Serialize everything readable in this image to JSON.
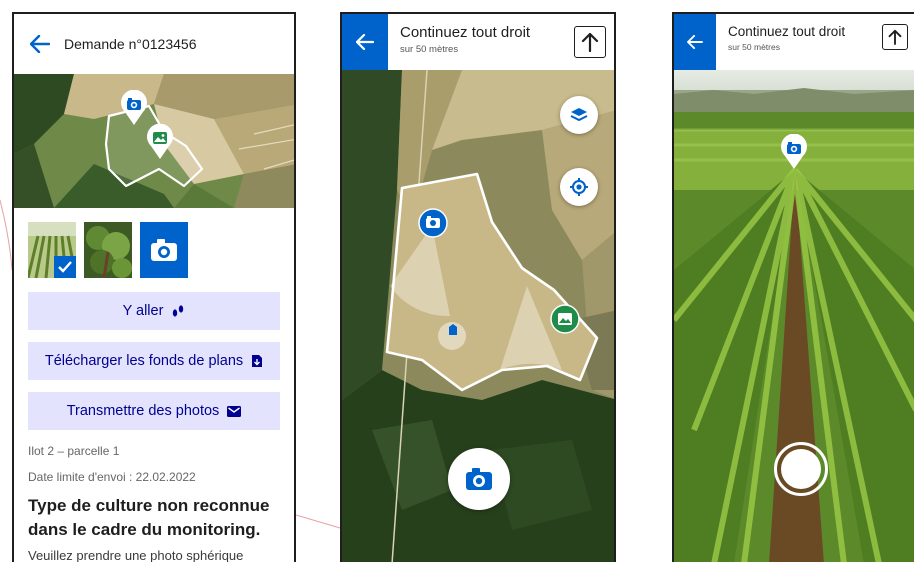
{
  "screen1": {
    "request_title": "Demande n°0123456",
    "buttons": {
      "go": "Y aller",
      "download": "Télécharger les fonds de plans",
      "send": "Transmettre des photos"
    },
    "parcel": "Ilot 2 – parcelle 1",
    "deadline": "Date limite d'envoi : 22.02.2022",
    "message": "Type  de culture non reconnue dans le cadre du monitoring.",
    "message_more": "Veuillez prendre une photo sphérique"
  },
  "screen2": {
    "instruction": "Continuez tout droit",
    "distance": "sur 50 mètres"
  },
  "screen3": {
    "instruction": "Continuez tout droit",
    "distance": "sur 50 mètres"
  },
  "colors": {
    "primary_blue": "#0063cb",
    "button_bg": "#e3e3fd",
    "button_text": "#000091",
    "photo_green": "#1f8d49"
  },
  "icons": [
    "back-arrow-icon",
    "camera-icon",
    "image-icon",
    "walk-icon",
    "download-icon",
    "mail-icon",
    "layers-icon",
    "locate-icon",
    "direction-up-icon",
    "check-icon",
    "user-location-icon"
  ]
}
